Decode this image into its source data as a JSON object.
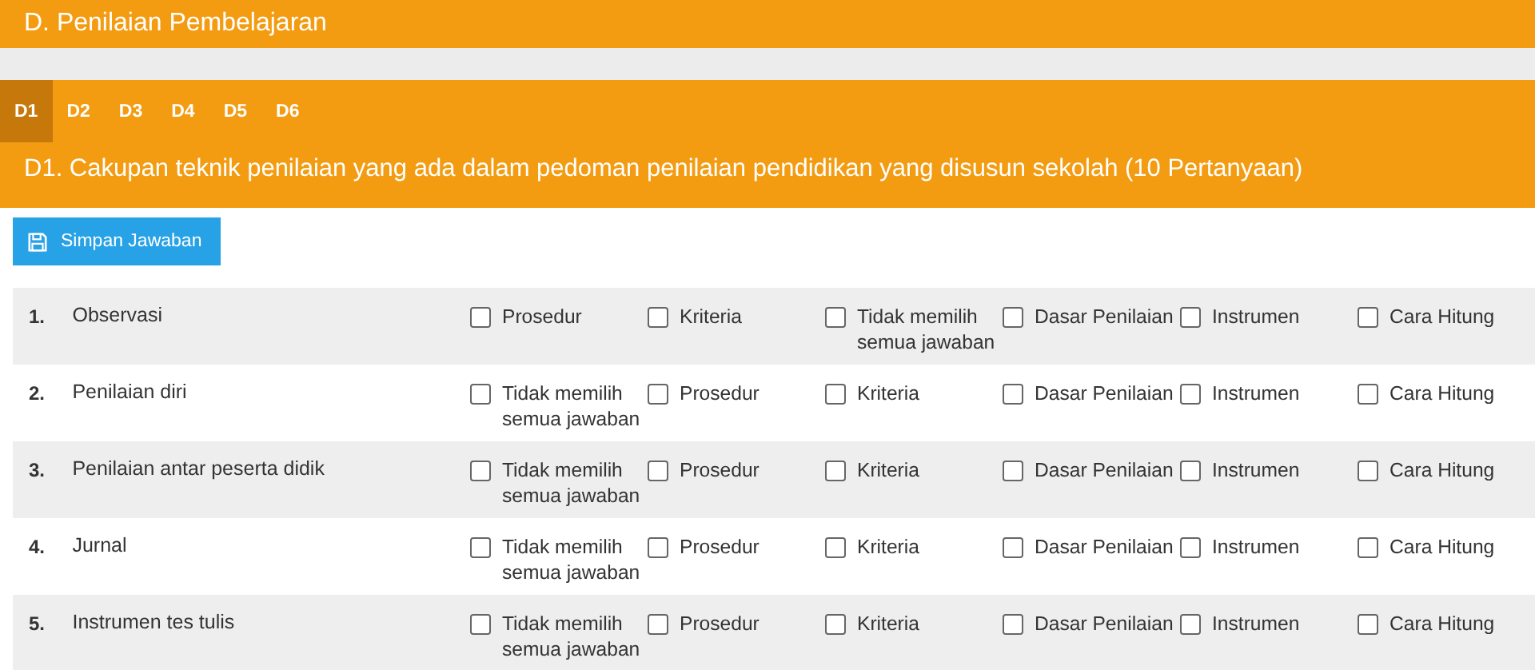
{
  "header": {
    "title": "D. Penilaian Pembelajaran"
  },
  "tabs": [
    {
      "label": "D1",
      "selected": true
    },
    {
      "label": "D2",
      "selected": false
    },
    {
      "label": "D3",
      "selected": false
    },
    {
      "label": "D4",
      "selected": false
    },
    {
      "label": "D5",
      "selected": false
    },
    {
      "label": "D6",
      "selected": false
    }
  ],
  "section_title": "D1. Cakupan teknik penilaian yang ada dalam pedoman penilaian pendidikan yang disusun sekolah (10 Pertanyaan)",
  "save_button": {
    "label": "Simpan Jawaban"
  },
  "questions": [
    {
      "number": "1.",
      "text": "Observasi",
      "options": [
        {
          "label": "Prosedur",
          "checked": false
        },
        {
          "label": "Kriteria",
          "checked": false
        },
        {
          "label": "Tidak memilih semua jawaban",
          "checked": false
        },
        {
          "label": "Dasar Penilaian",
          "checked": false
        },
        {
          "label": "Instrumen",
          "checked": false
        },
        {
          "label": "Cara Hitung",
          "checked": false
        }
      ]
    },
    {
      "number": "2.",
      "text": "Penilaian diri",
      "options": [
        {
          "label": "Tidak memilih semua jawaban",
          "checked": false
        },
        {
          "label": "Prosedur",
          "checked": false
        },
        {
          "label": "Kriteria",
          "checked": false
        },
        {
          "label": "Dasar Penilaian",
          "checked": false
        },
        {
          "label": "Instrumen",
          "checked": false
        },
        {
          "label": "Cara Hitung",
          "checked": false
        }
      ]
    },
    {
      "number": "3.",
      "text": "Penilaian antar peserta didik",
      "options": [
        {
          "label": "Tidak memilih semua jawaban",
          "checked": false
        },
        {
          "label": "Prosedur",
          "checked": false
        },
        {
          "label": "Kriteria",
          "checked": false
        },
        {
          "label": "Dasar Penilaian",
          "checked": false
        },
        {
          "label": "Instrumen",
          "checked": false
        },
        {
          "label": "Cara Hitung",
          "checked": false
        }
      ]
    },
    {
      "number": "4.",
      "text": "Jurnal",
      "options": [
        {
          "label": "Tidak memilih semua jawaban",
          "checked": false
        },
        {
          "label": "Prosedur",
          "checked": false
        },
        {
          "label": "Kriteria",
          "checked": false
        },
        {
          "label": "Dasar Penilaian",
          "checked": false
        },
        {
          "label": "Instrumen",
          "checked": false
        },
        {
          "label": "Cara Hitung",
          "checked": false
        }
      ]
    },
    {
      "number": "5.",
      "text": "Instrumen tes tulis",
      "options": [
        {
          "label": "Tidak memilih semua jawaban",
          "checked": false
        },
        {
          "label": "Prosedur",
          "checked": false
        },
        {
          "label": "Kriteria",
          "checked": false
        },
        {
          "label": "Dasar Penilaian",
          "checked": false
        },
        {
          "label": "Instrumen",
          "checked": false
        },
        {
          "label": "Cara Hitung",
          "checked": false
        }
      ]
    }
  ]
}
